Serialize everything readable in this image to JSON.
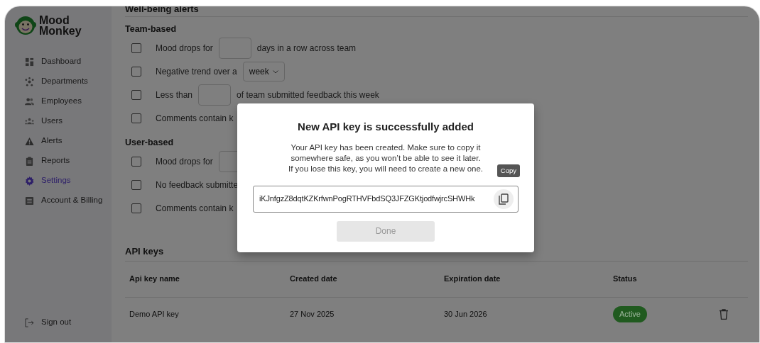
{
  "sidebar": {
    "logo": {
      "line1": "Mood",
      "line2": "Monkey"
    },
    "items": [
      {
        "label": "Dashboard",
        "kind": "grid",
        "selected": false
      },
      {
        "label": "Departments",
        "kind": "network",
        "selected": false
      },
      {
        "label": "Employees",
        "kind": "people",
        "selected": false
      },
      {
        "label": "Users",
        "kind": "group",
        "selected": false
      },
      {
        "label": "Alerts",
        "kind": "warning",
        "selected": false
      },
      {
        "label": "Reports",
        "kind": "clipboard",
        "selected": false
      },
      {
        "label": "Settings",
        "kind": "gear",
        "selected": true
      },
      {
        "label": "Account & Billing",
        "kind": "document",
        "selected": false
      }
    ],
    "sign_out": "Sign out"
  },
  "alerts": {
    "title": "Well-being alerts",
    "groups": [
      {
        "title": "Team-based",
        "rules": [
          {
            "checked": false,
            "parts": [
              {
                "kind": "text",
                "text": "Mood drops for"
              },
              {
                "kind": "input"
              },
              {
                "kind": "text",
                "text": "days in a row across team"
              }
            ]
          },
          {
            "checked": false,
            "parts": [
              {
                "kind": "text",
                "text": "Negative trend over a"
              },
              {
                "kind": "select",
                "value": "week"
              }
            ]
          },
          {
            "checked": false,
            "parts": [
              {
                "kind": "text",
                "text": "Less than"
              },
              {
                "kind": "input"
              },
              {
                "kind": "text",
                "text": "of team submitted feedback this week"
              }
            ]
          },
          {
            "checked": false,
            "parts": [
              {
                "kind": "text",
                "text": "Comments contain k"
              }
            ]
          }
        ]
      },
      {
        "title": "User-based",
        "rules": [
          {
            "checked": false,
            "parts": [
              {
                "kind": "text",
                "text": "Mood drops for"
              },
              {
                "kind": "input"
              }
            ]
          },
          {
            "checked": false,
            "parts": [
              {
                "kind": "text",
                "text": "No feedback submitte"
              }
            ]
          },
          {
            "checked": false,
            "parts": [
              {
                "kind": "text",
                "text": "Comments contain k"
              }
            ]
          }
        ]
      }
    ]
  },
  "api_keys": {
    "title": "API keys",
    "columns": [
      "Api key name",
      "Created date",
      "Expiration date",
      "Status"
    ],
    "rows": [
      {
        "name": "Demo API key",
        "created": "27 Nov 2025",
        "expires": "30 Jun 2026",
        "status": {
          "label": "Active",
          "color": "#205a1f"
        }
      }
    ]
  },
  "modal": {
    "title": "New API key is successfully added",
    "message_lines": [
      "Your API key has been created. Make sure to copy it",
      "somewhere safe, as you won’t be able to see it later.",
      "If you lose this key, you will need to create a new one."
    ],
    "key": "iKJnfgzZ8dqtKZKrfwnPogRTHVFbdSQ3JFZGKtjodfwjrcSHWHk",
    "tooltip": "Copy",
    "done": {
      "label": "Done",
      "disabled": true
    }
  }
}
